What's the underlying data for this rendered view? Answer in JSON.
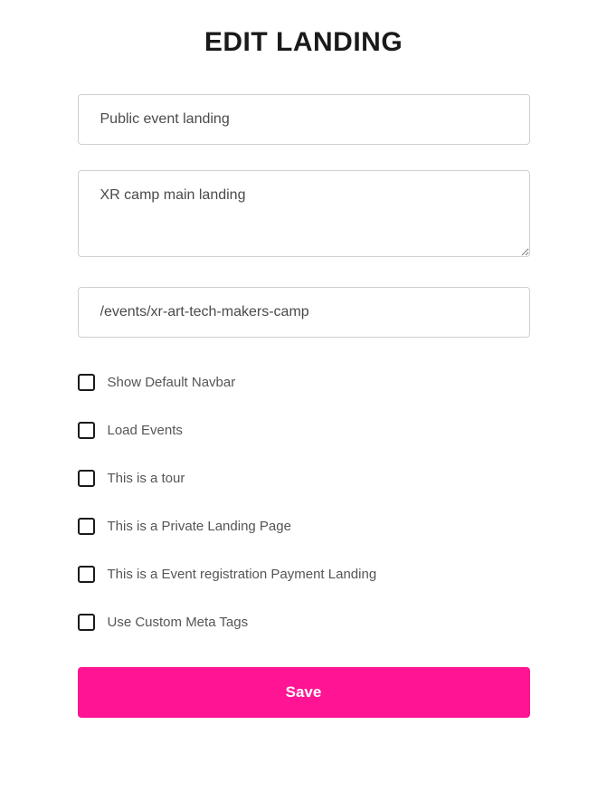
{
  "page_title": "EDIT LANDING",
  "fields": {
    "title": {
      "value": "Public event landing",
      "placeholder": ""
    },
    "description": {
      "value": "XR camp main landing",
      "placeholder": ""
    },
    "url": {
      "value": "/events/xr-art-tech-makers-camp",
      "placeholder": ""
    }
  },
  "checkboxes": {
    "show_navbar": {
      "label": "Show Default Navbar",
      "checked": false
    },
    "load_events": {
      "label": "Load Events",
      "checked": false
    },
    "is_tour": {
      "label": "This is a tour",
      "checked": false
    },
    "is_private": {
      "label": "This is a Private Landing Page",
      "checked": false
    },
    "is_payment": {
      "label": "This is a Event registration Payment Landing",
      "checked": false
    },
    "custom_meta": {
      "label": "Use Custom Meta Tags",
      "checked": false
    }
  },
  "buttons": {
    "save_label": "Save"
  },
  "colors": {
    "accent": "#ff1493"
  }
}
